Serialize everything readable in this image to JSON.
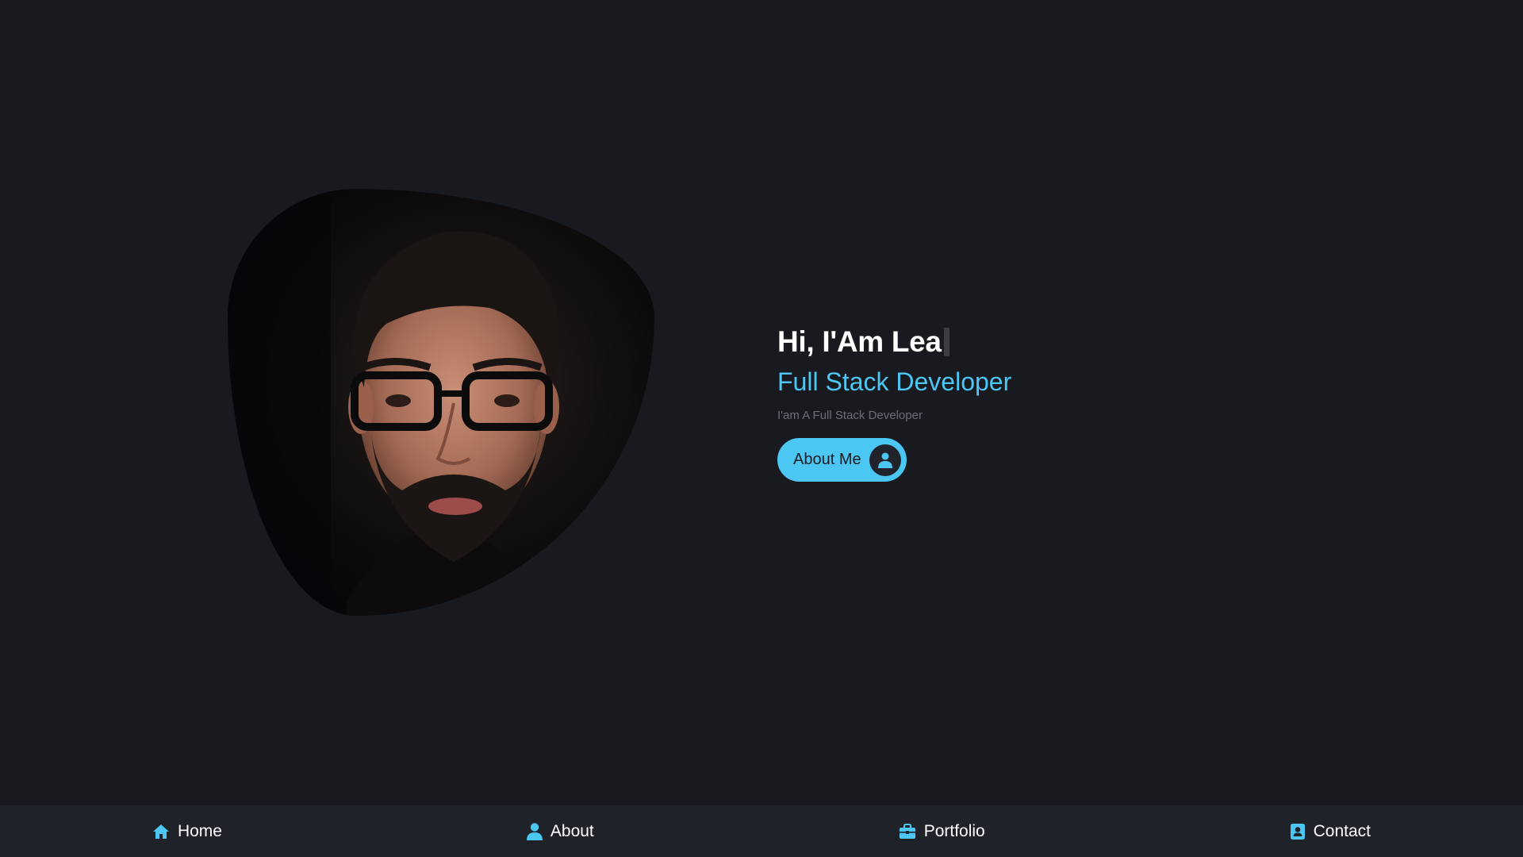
{
  "hero": {
    "title": "Hi, I'Am Lea",
    "role": "Full Stack Developer",
    "subtitle": "I'am A Full Stack Developer",
    "button_label": "About Me",
    "button_icon": "user-icon"
  },
  "nav": {
    "items": [
      {
        "label": "Home",
        "icon": "home-icon"
      },
      {
        "label": "About",
        "icon": "user-icon"
      },
      {
        "label": "Portfolio",
        "icon": "briefcase-icon"
      },
      {
        "label": "Contact",
        "icon": "contact-card-icon"
      }
    ]
  },
  "colors": {
    "background": "#181a1f",
    "nav_background": "#1f2229",
    "accent": "#4cc6f2",
    "text": "#ffffff",
    "muted": "#6b6e75"
  }
}
